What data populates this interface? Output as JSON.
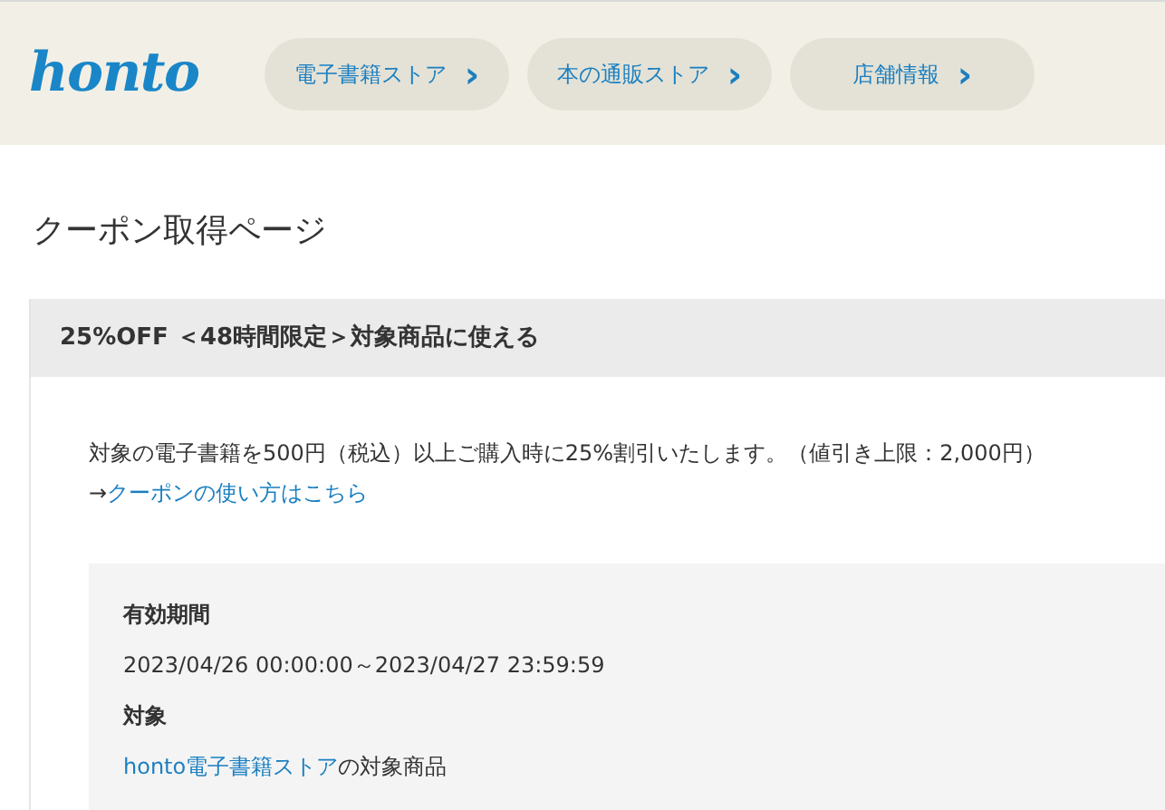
{
  "header": {
    "logo": "honto",
    "nav": [
      {
        "label": "電子書籍ストア",
        "icon": "›"
      },
      {
        "label": "本の通販ストア",
        "icon": "›"
      },
      {
        "label": "店舗情報",
        "icon": "›"
      }
    ]
  },
  "page_title": "クーポン取得ページ",
  "coupon": {
    "title": "25%OFF ＜48時間限定＞対象商品に使える",
    "description": "対象の電子書籍を500円（税込）以上ご購入時に25%割引いたします。（値引き上限：2,000円）",
    "howto": {
      "arrow": "→",
      "link": "クーポンの使い方はこちら"
    },
    "details": [
      {
        "kind": "text",
        "label": "有効期間",
        "value": "2023/04/26 00:00:00～2023/04/27 23:59:59"
      },
      {
        "kind": "link",
        "label": "対象",
        "link": "honto電子書籍ストア",
        "value": "の対象商品"
      }
    ]
  }
}
